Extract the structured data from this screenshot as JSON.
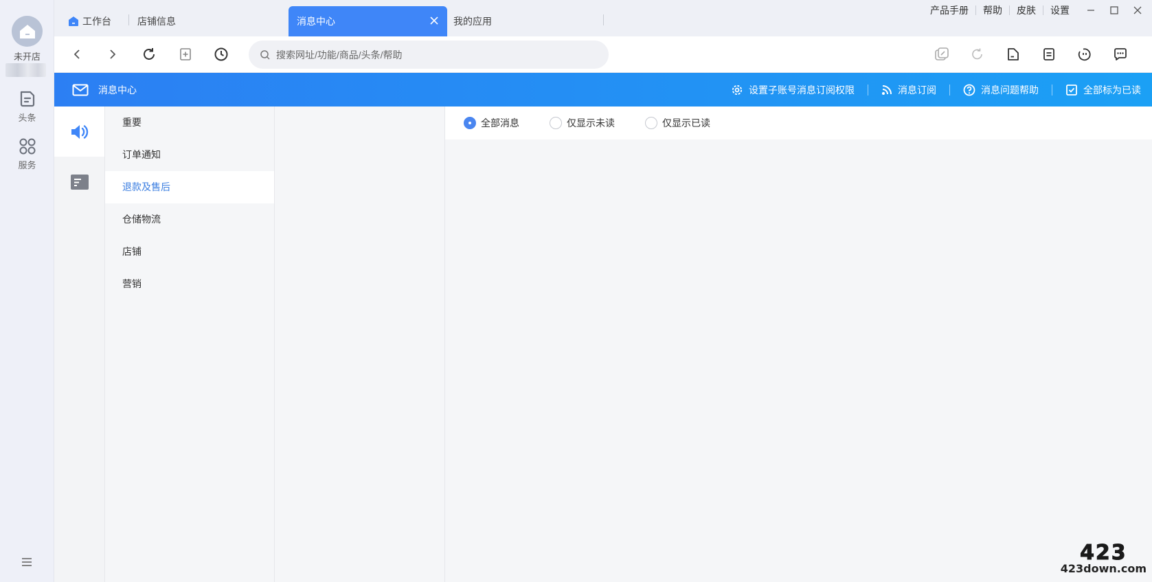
{
  "rail": {
    "store_label": "未开店",
    "items": [
      {
        "label": "头条",
        "icon": "news-icon"
      },
      {
        "label": "服务",
        "icon": "grid-icon"
      }
    ]
  },
  "tabs": {
    "workbench": "工作台",
    "store_info": "店铺信息",
    "message_center": "消息中心",
    "my_apps": "我的应用"
  },
  "top_links": {
    "manual": "产品手册",
    "help": "帮助",
    "skin": "皮肤",
    "settings": "设置"
  },
  "search": {
    "placeholder": "搜索网址/功能/商品/头条/帮助"
  },
  "header": {
    "title": "消息中心",
    "actions": {
      "sub_account": "设置子账号消息订阅权限",
      "subscribe": "消息订阅",
      "help": "消息问题帮助",
      "mark_all_read": "全部标为已读"
    }
  },
  "categories": [
    {
      "label": "重要"
    },
    {
      "label": "订单通知"
    },
    {
      "label": "退款及售后",
      "active": true
    },
    {
      "label": "仓储物流"
    },
    {
      "label": "店铺"
    },
    {
      "label": "营销"
    }
  ],
  "filters": {
    "all": "全部消息",
    "unread": "仅显示未读",
    "read": "仅显示已读",
    "selected": "all"
  },
  "watermark": {
    "big": "423",
    "small": "423down.com"
  },
  "colors": {
    "accent": "#3f86f8",
    "header_start": "#2c7ff3",
    "header_end": "#1ba0f5",
    "active_text": "#3a7de0"
  }
}
